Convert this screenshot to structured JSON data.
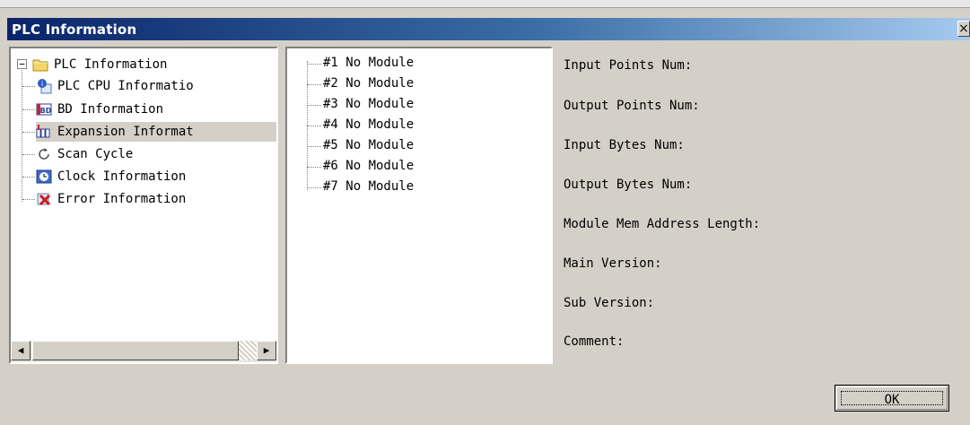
{
  "window": {
    "title": "PLC Information",
    "close_label": "×"
  },
  "tree": {
    "root": {
      "label": "PLC Information",
      "expander": "−"
    },
    "items": [
      {
        "label": "PLC CPU Informatio",
        "icon": "cpu-info-icon"
      },
      {
        "label": "BD Information",
        "icon": "bd-icon"
      },
      {
        "label": "Expansion Informat",
        "icon": "expansion-icon",
        "selected": true
      },
      {
        "label": "Scan Cycle",
        "icon": "refresh-icon"
      },
      {
        "label": "Clock Information",
        "icon": "clock-icon"
      },
      {
        "label": "Error Information",
        "icon": "error-icon"
      }
    ]
  },
  "scrollbar": {
    "left_arrow": "◀",
    "right_arrow": "▶"
  },
  "modules": [
    "#1 No Module",
    "#2 No Module",
    "#3 No Module",
    "#4 No Module",
    "#5 No Module",
    "#6 No Module",
    "#7 No Module"
  ],
  "info_fields": [
    "Input Points Num:",
    "Output Points Num:",
    "Input Bytes Num:",
    "Output Bytes Num:",
    "Module Mem Address Length:",
    "Main Version:",
    "Sub Version:",
    "Comment:"
  ],
  "buttons": {
    "ok": "OK"
  },
  "colors": {
    "titlebar_start": "#0a246a",
    "titlebar_end": "#a6caf0",
    "dialog_bg": "#d4d0c8",
    "selected_bg": "#d4d0c8"
  }
}
